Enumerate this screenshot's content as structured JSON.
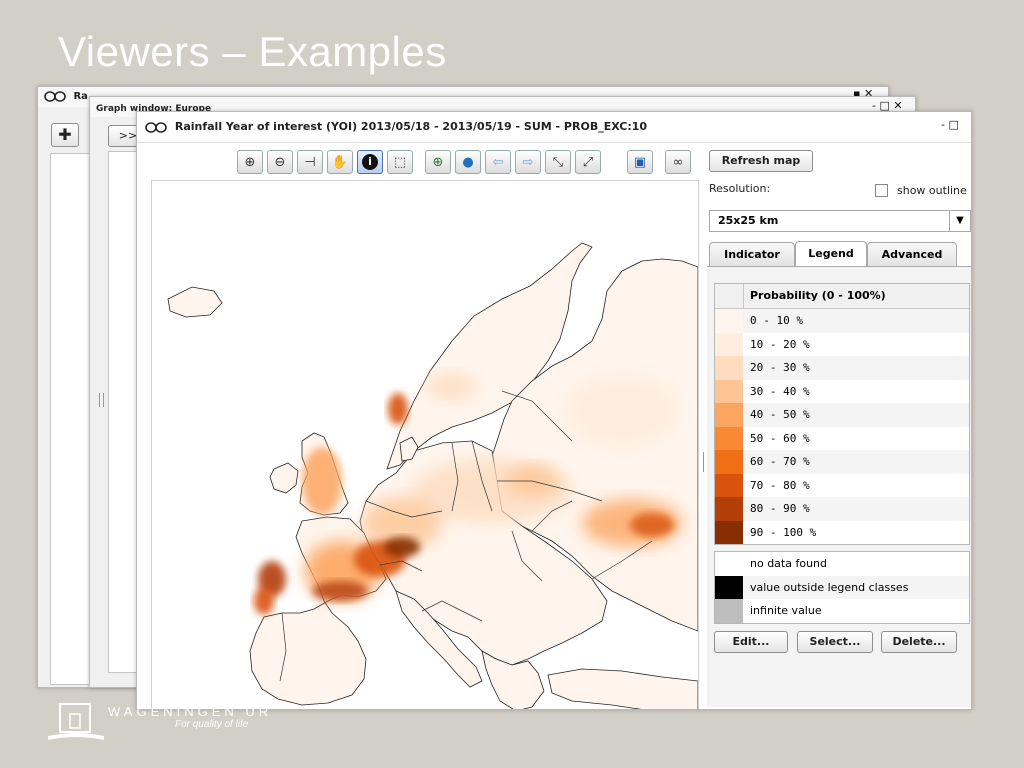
{
  "slide": {
    "title": "Viewers – Examples"
  },
  "window_back": {
    "title": "Ra",
    "controls": "▪ ✕"
  },
  "window_graph": {
    "title": "Graph window: Europe",
    "expand_label": ">>",
    "controls": "- □ ✕"
  },
  "window_main": {
    "title": "Rainfall Year of interest (YOI) 2013/05/18 - 2013/05/19 - SUM - PROB_EXC:10",
    "controls": "- □"
  },
  "toolbar": {
    "buttons": [
      {
        "icon": "zoom-in-icon",
        "glyph": "⊕"
      },
      {
        "icon": "zoom-out-icon",
        "glyph": "⊖"
      },
      {
        "icon": "measure-icon",
        "glyph": "⊣"
      },
      {
        "icon": "pan-hand-icon",
        "glyph": "✋"
      },
      {
        "icon": "info-icon",
        "glyph": "i"
      },
      {
        "icon": "select-area-icon",
        "glyph": "⬚"
      },
      {
        "icon": "zoom-region-icon",
        "glyph": "⊕"
      },
      {
        "icon": "globe-icon",
        "glyph": "●"
      },
      {
        "icon": "back-arrow-icon",
        "glyph": "⇦"
      },
      {
        "icon": "forward-arrow-icon",
        "glyph": "⇨"
      },
      {
        "icon": "shrink-icon",
        "glyph": "⤡"
      },
      {
        "icon": "expand-icon",
        "glyph": "⤢"
      },
      {
        "icon": "save-icon",
        "glyph": "▣"
      },
      {
        "icon": "app-logo-icon",
        "glyph": "∞"
      }
    ]
  },
  "side": {
    "refresh_label": "Refresh map",
    "resolution_label": "Resolution:",
    "show_outline_label": "show outline",
    "resolution_value": "25x25 km",
    "tabs": [
      "Indicator",
      "Legend",
      "Advanced"
    ],
    "selected_tab": "Legend",
    "legend_header": "Probability (0 - 100%)",
    "legend": [
      {
        "label": "0 - 10 %",
        "color": "#fff5ed"
      },
      {
        "label": "10 - 20 %",
        "color": "#feeee0"
      },
      {
        "label": "20 - 30 %",
        "color": "#fddcbf"
      },
      {
        "label": "30 - 40 %",
        "color": "#fdc593"
      },
      {
        "label": "40 - 50 %",
        "color": "#fca560"
      },
      {
        "label": "50 - 60 %",
        "color": "#f98932"
      },
      {
        "label": "60 - 70 %",
        "color": "#f07018"
      },
      {
        "label": "70 - 80 %",
        "color": "#d9530c"
      },
      {
        "label": "80 - 90 %",
        "color": "#b43e07"
      },
      {
        "label": "90 - 100 %",
        "color": "#872e05"
      }
    ],
    "special": [
      {
        "label": "no data found",
        "color": "#ffffff"
      },
      {
        "label": "value outside legend classes",
        "color": "#000000"
      },
      {
        "label": "infinite value",
        "color": "#bdbdbd"
      }
    ],
    "edit_label": "Edit...",
    "select_label": "Select...",
    "delete_label": "Delete..."
  },
  "footer": {
    "brand": "WAGENINGEN UR",
    "tagline": "For quality of life"
  }
}
